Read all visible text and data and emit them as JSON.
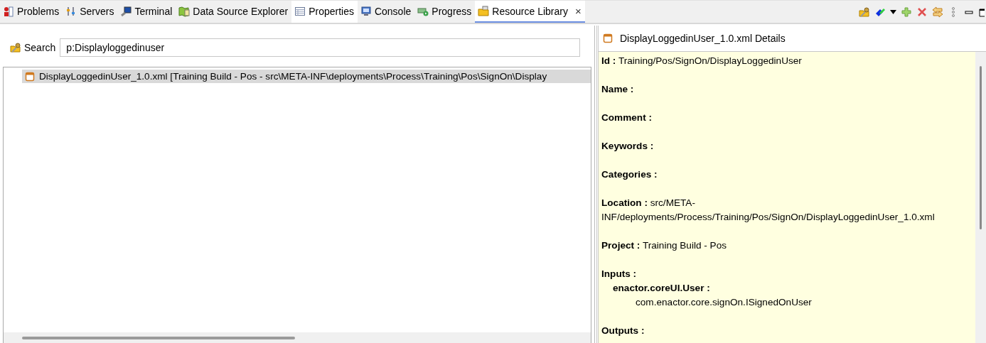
{
  "tabs": [
    {
      "label": "Problems",
      "kind": "problems",
      "selected": false
    },
    {
      "label": "Servers",
      "kind": "servers",
      "selected": false
    },
    {
      "label": "Terminal",
      "kind": "terminal",
      "selected": false
    },
    {
      "label": "Data Source Explorer",
      "kind": "datasource",
      "selected": false
    },
    {
      "label": "Properties",
      "kind": "properties",
      "selected": false
    },
    {
      "label": "Console",
      "kind": "console",
      "selected": false
    },
    {
      "label": "Progress",
      "kind": "progress",
      "selected": false
    },
    {
      "label": "Resource Library",
      "kind": "library",
      "selected": true,
      "close": "×"
    }
  ],
  "search": {
    "label": "Search",
    "value": "p:Displayloggedinuser"
  },
  "results": [
    {
      "label": "DisplayLoggedinUser_1.0.xml [Training Build - Pos - src\\META-INF\\deployments\\Process\\Training\\Pos\\SignOn\\Display",
      "selected": true
    }
  ],
  "details": {
    "title": "DisplayLoggedinUser_1.0.xml Details",
    "fields": [
      {
        "label": "Id :",
        "value": "Training/Pos/SignOn/DisplayLoggedinUser"
      },
      {
        "label": "Name :"
      },
      {
        "label": "Comment :"
      },
      {
        "label": "Keywords :"
      },
      {
        "label": "Categories :"
      },
      {
        "label": "Location :",
        "value": "src/META-INF/deployments/Process/Training/Pos/SignOn/DisplayLoggedinUser_1.0.xml"
      },
      {
        "label": "Project :",
        "value": "Training Build - Pos"
      },
      {
        "label": "Inputs :",
        "children": [
          {
            "label": "enactor.coreUI.User :",
            "value": "com.enactor.core.signOn.ISignedOnUser"
          }
        ]
      },
      {
        "label": "Outputs :"
      }
    ]
  }
}
